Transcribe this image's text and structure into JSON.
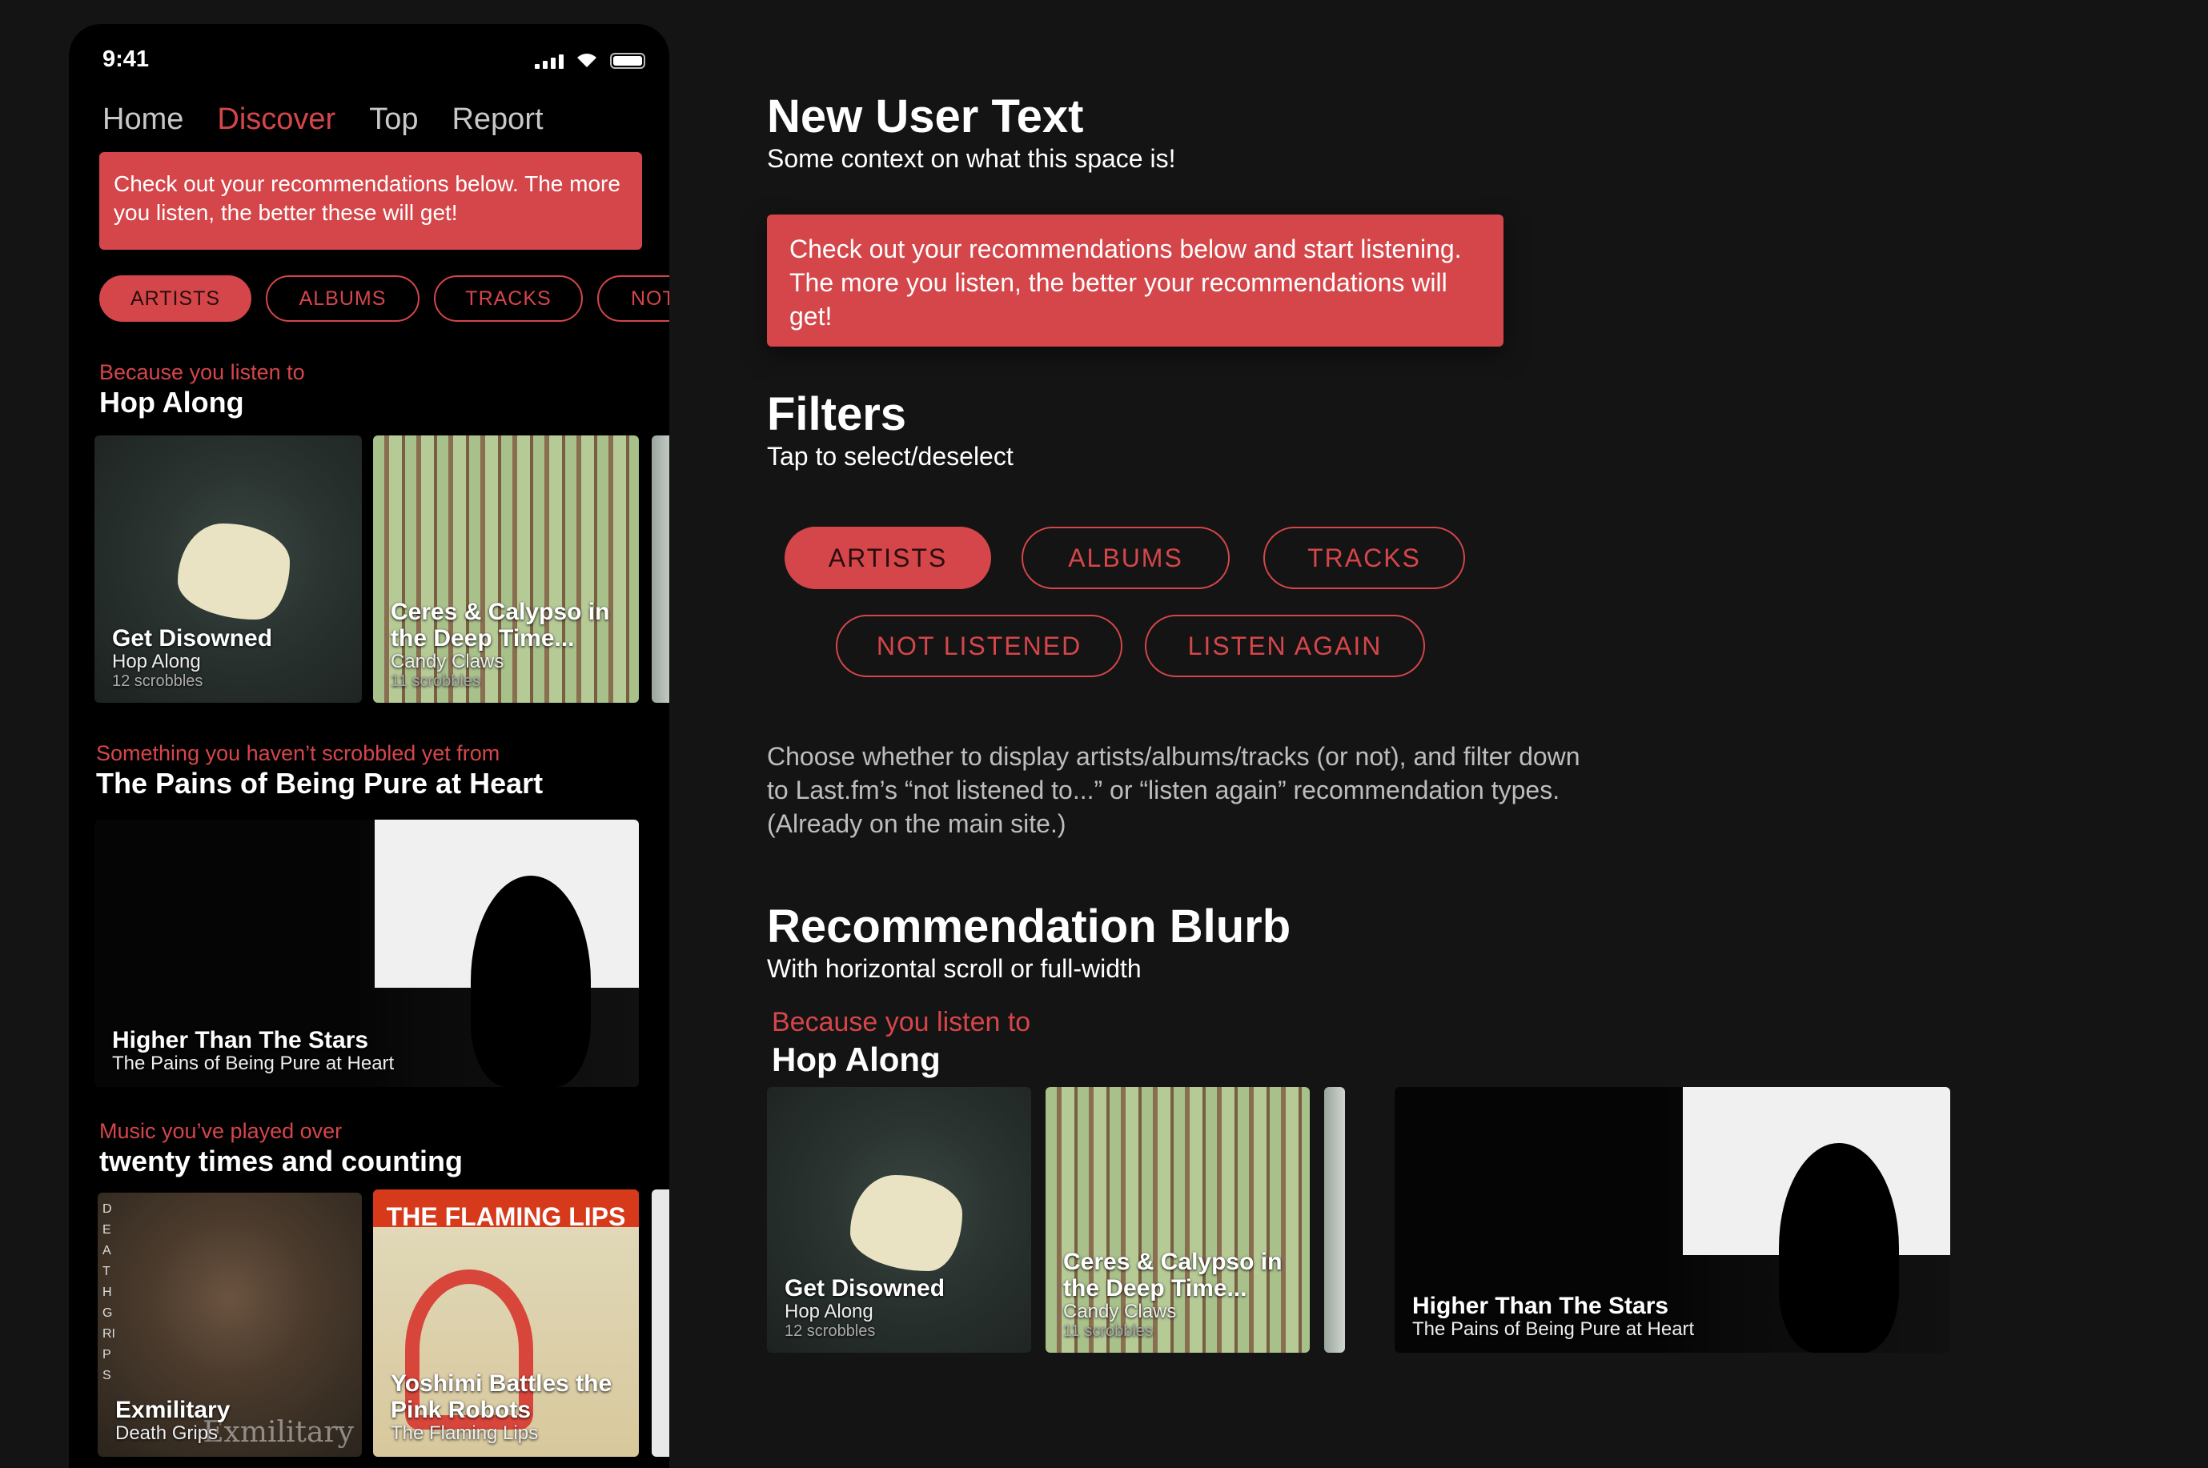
{
  "phone": {
    "time": "9:41",
    "nav": [
      "Home",
      "Discover",
      "Top",
      "Report"
    ],
    "nav_active": "Discover",
    "banner": "Check out your recommendations below. The more you listen, the better these will get!",
    "pills": [
      "ARTISTS",
      "ALBUMS",
      "TRACKS",
      "NOT"
    ],
    "sections": [
      {
        "label": "Because you listen to",
        "title": "Hop Along"
      },
      {
        "label": "Something you haven’t scrobbled yet from",
        "title": "The Pains of Being Pure at Heart"
      },
      {
        "label": "Music you’ve played over",
        "title": "twenty times and counting"
      }
    ],
    "cards": [
      {
        "title": "Get Disowned",
        "artist": "Hop Along",
        "scrobbles": "12 scrobbles"
      },
      {
        "title": "Ceres & Calypso in the Deep Time...",
        "artist": "Candy Claws",
        "scrobbles": "11 scrobbles"
      },
      {
        "title": "Higher Than The Stars",
        "artist": "The Pains of Being Pure at Heart"
      },
      {
        "title": "Exmilitary",
        "artist": "Death Grips"
      },
      {
        "title": "Yoshimi Battles the Pink Robots",
        "artist": "The Flaming Lips"
      }
    ],
    "art_text": {
      "flaming_lips": "THE FLAMING LIPS",
      "exmilitary_script": "Exmilitary",
      "death_grips_vertical": "DEATH GRIPS"
    }
  },
  "right": {
    "new_user": {
      "title": "New User Text",
      "subtitle": "Some context on what this space is!"
    },
    "banner": "Check out your recommendations below and start listening. The more you listen, the better your recommendations will get!",
    "filters": {
      "title": "Filters",
      "subtitle": "Tap to select/deselect"
    },
    "pills_row1": [
      "ARTISTS",
      "ALBUMS",
      "TRACKS"
    ],
    "pills_row2": [
      "NOT LISTENED",
      "LISTEN AGAIN"
    ],
    "description": "Choose whether to display artists/albums/tracks (or not), and filter down to Last.fm’s “not listened to...” or “listen again” recommendation types. (Already on the main site.)",
    "blurb": {
      "title": "Recommendation Blurb",
      "subtitle": "With horizontal scroll or full-width"
    },
    "blurb_label": "Because you listen to",
    "blurb_artist": "Hop Along"
  },
  "colors": {
    "accent": "#d5464a",
    "background": "#141414",
    "phone_bg": "#000000"
  }
}
